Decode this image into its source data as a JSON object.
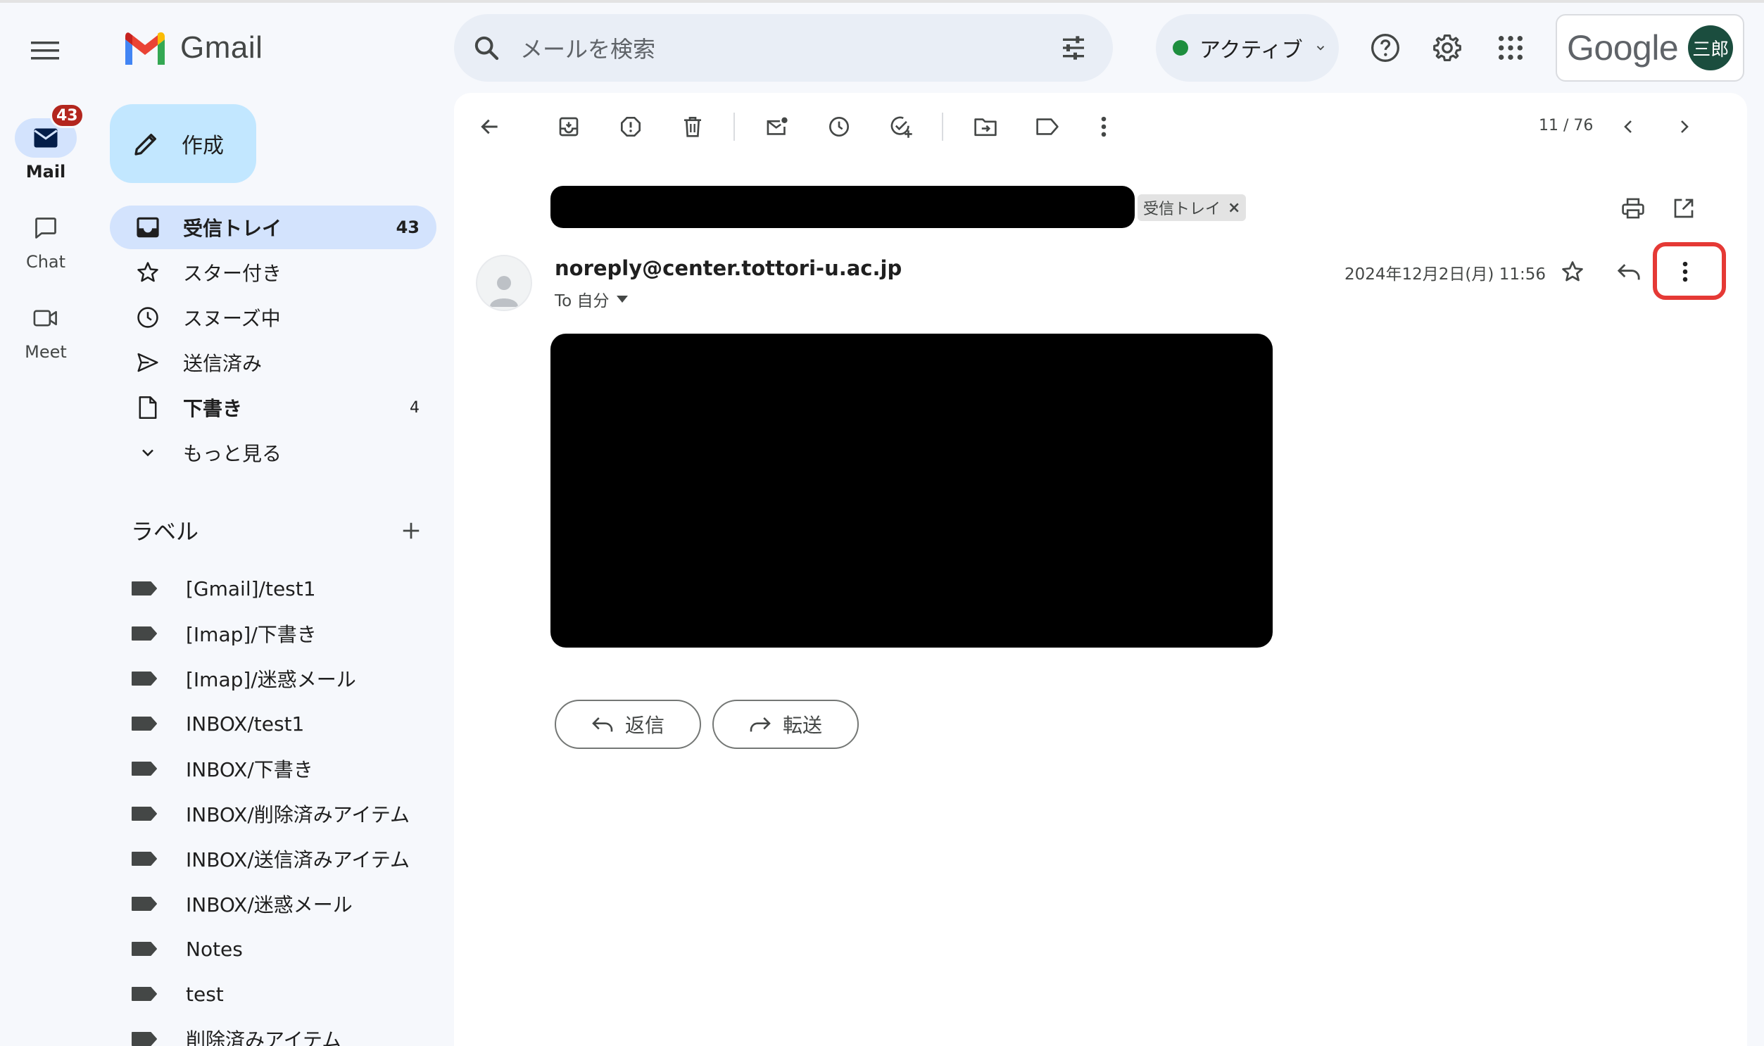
{
  "app": {
    "name": "Gmail"
  },
  "search": {
    "placeholder": "メールを検索"
  },
  "status": {
    "label": "アクティブ",
    "color": "#1e8e3e"
  },
  "account": {
    "brand": "Google",
    "avatar_text": "三郎"
  },
  "rail": {
    "items": [
      {
        "label": "Mail",
        "badge": "43",
        "active": true
      },
      {
        "label": "Chat"
      },
      {
        "label": "Meet"
      }
    ]
  },
  "compose": {
    "label": "作成"
  },
  "nav": {
    "items": [
      {
        "label": "受信トレイ",
        "count": "43",
        "active": true,
        "bold": true,
        "icon": "inbox-icon"
      },
      {
        "label": "スター付き",
        "icon": "star-icon"
      },
      {
        "label": "スヌーズ中",
        "icon": "clock-icon"
      },
      {
        "label": "送信済み",
        "icon": "send-icon"
      },
      {
        "label": "下書き",
        "count": "4",
        "bold": true,
        "icon": "draft-icon"
      },
      {
        "label": "もっと見る",
        "icon": "chevron-down-icon"
      }
    ]
  },
  "labels": {
    "title": "ラベル",
    "items": [
      "[Gmail]/test1",
      "[Imap]/下書き",
      "[Imap]/迷惑メール",
      "INBOX/test1",
      "INBOX/下書き",
      "INBOX/削除済みアイテム",
      "INBOX/送信済みアイテム",
      "INBOX/迷惑メール",
      "Notes",
      "test",
      "削除済みアイテム"
    ]
  },
  "toolbar": {
    "pager": "11 / 76"
  },
  "message": {
    "chip": "受信トレイ",
    "chip_close": "×",
    "sender": "noreply@center.tottori-u.ac.jp",
    "to": "To 自分",
    "datetime": "2024年12月2日(月) 11:56"
  },
  "actions": {
    "reply": "返信",
    "forward": "転送"
  },
  "colors": {
    "accent": "#c2e7ff",
    "active_nav": "#d3e3fd",
    "highlight": "#e53935",
    "badge": "#b3261e",
    "avatar": "#1b4d3e"
  }
}
